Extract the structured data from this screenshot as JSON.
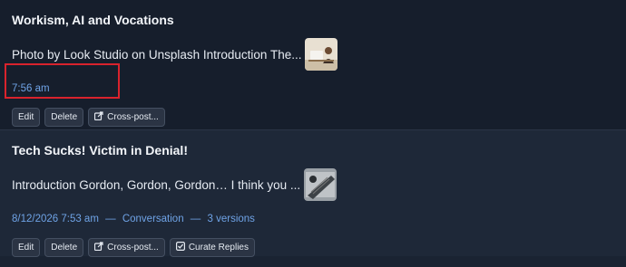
{
  "posts": [
    {
      "title": "Workism, AI and Vocations",
      "excerpt": "Photo by Look Studio on Unsplash Introduction The...",
      "time": "7:56 am",
      "buttons": {
        "edit": "Edit",
        "delete": "Delete",
        "crosspost": "Cross-post..."
      }
    },
    {
      "title": "Tech Sucks! Victim in Denial!",
      "excerpt": "Introduction Gordon, Gordon, Gordon… I think you ...",
      "datetime": "8/12/2026 7:53 am",
      "sep1": "—",
      "conversation": "Conversation",
      "sep2": "—",
      "versions": "3 versions",
      "buttons": {
        "edit": "Edit",
        "delete": "Delete",
        "crosspost": "Cross-post...",
        "curate": "Curate Replies"
      }
    }
  ],
  "colors": {
    "link": "#6fa3e6",
    "highlight": "#d9232d"
  },
  "icons": {
    "crosspost": "external-share-icon",
    "curate": "checkbox-icon"
  }
}
